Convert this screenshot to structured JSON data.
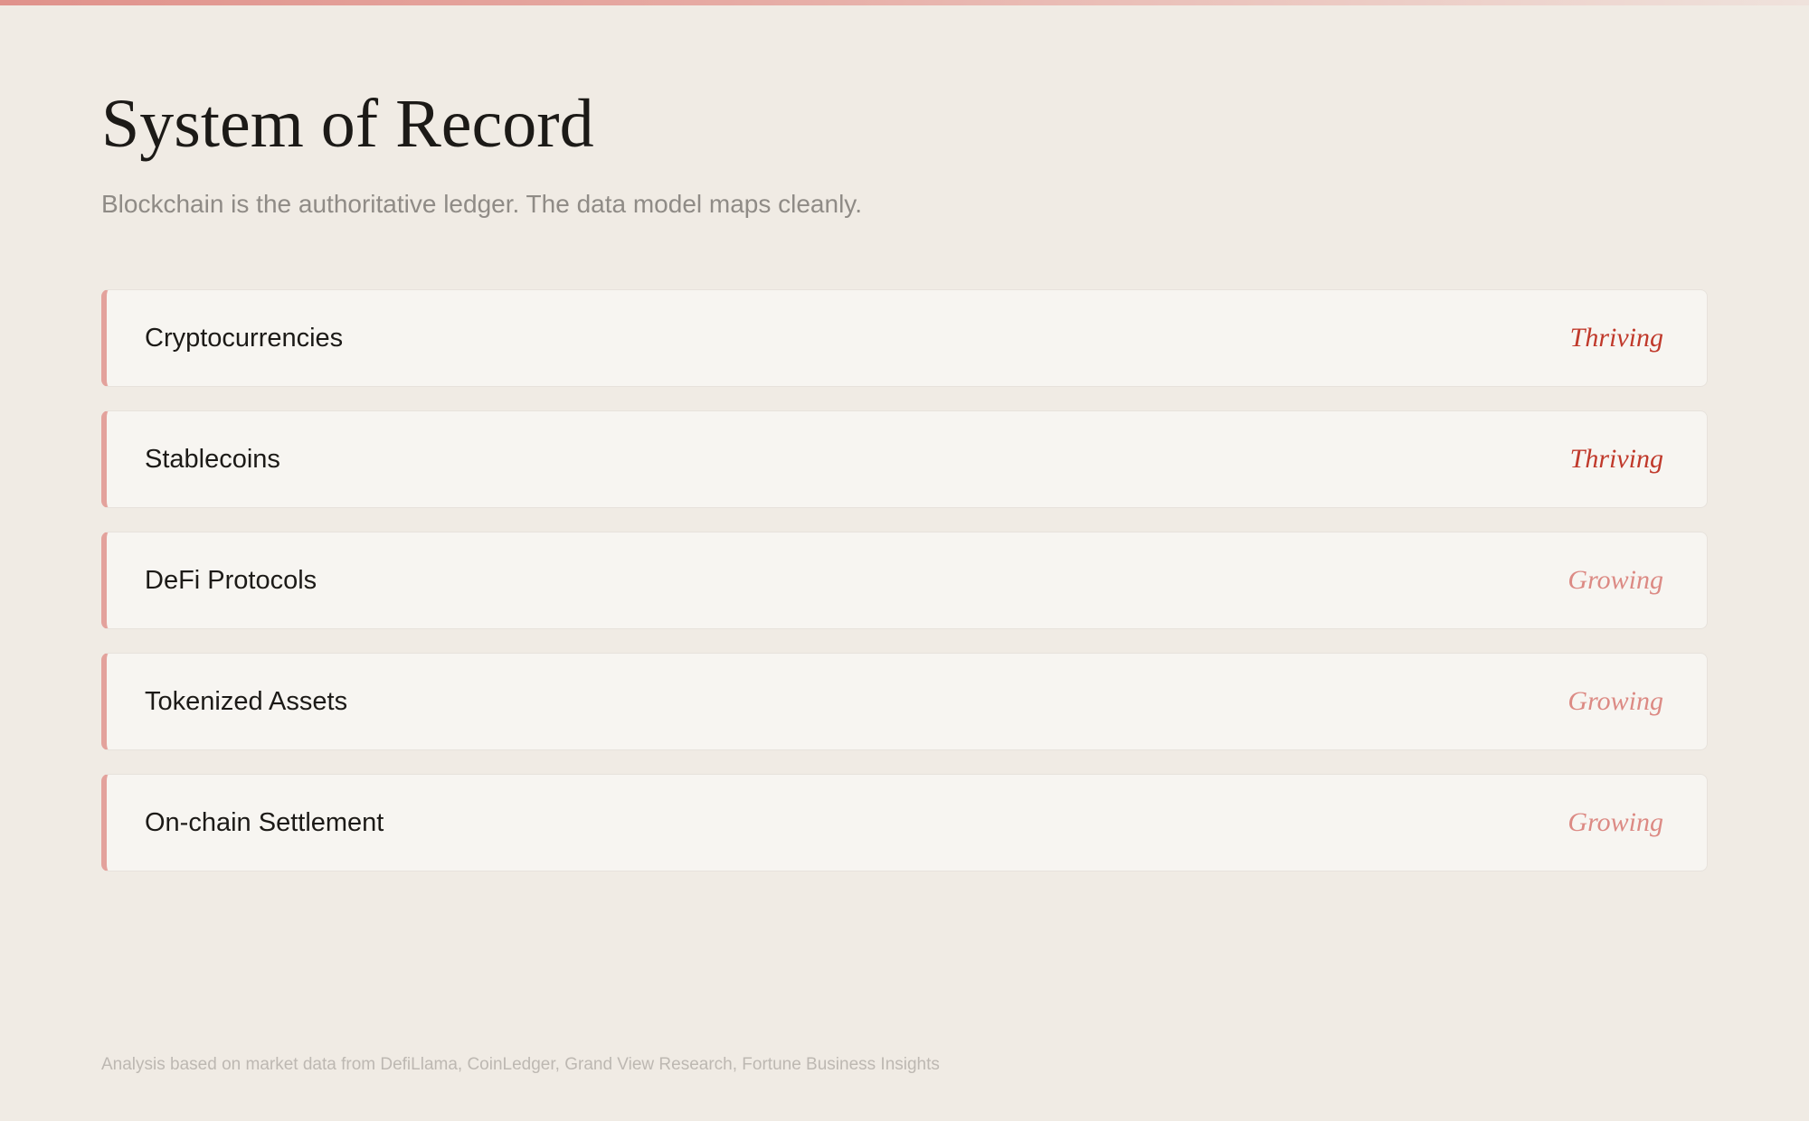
{
  "header": {
    "title": "System of Record",
    "subtitle": "Blockchain is the authoritative ledger. The data model maps cleanly."
  },
  "items": [
    {
      "label": "Cryptocurrencies",
      "status": "Thriving",
      "status_color": "#c0392b"
    },
    {
      "label": "Stablecoins",
      "status": "Thriving",
      "status_color": "#c0392b"
    },
    {
      "label": "DeFi Protocols",
      "status": "Growing",
      "status_color": "#dc8a84"
    },
    {
      "label": "Tokenized Assets",
      "status": "Growing",
      "status_color": "#dc8a84"
    },
    {
      "label": "On-chain Settlement",
      "status": "Growing",
      "status_color": "#dc8a84"
    }
  ],
  "footer": {
    "note": "Analysis based on market data from DefiLlama, CoinLedger, Grand View Research, Fortune Business Insights"
  },
  "colors": {
    "background": "#f0ebe4",
    "card_background": "#f7f5f1",
    "card_accent": "#e3a29c",
    "top_accent": "#e0928b",
    "title_text": "#1c1a17",
    "subtitle_text": "#8f8b86",
    "footer_text": "#bdb8b2"
  }
}
